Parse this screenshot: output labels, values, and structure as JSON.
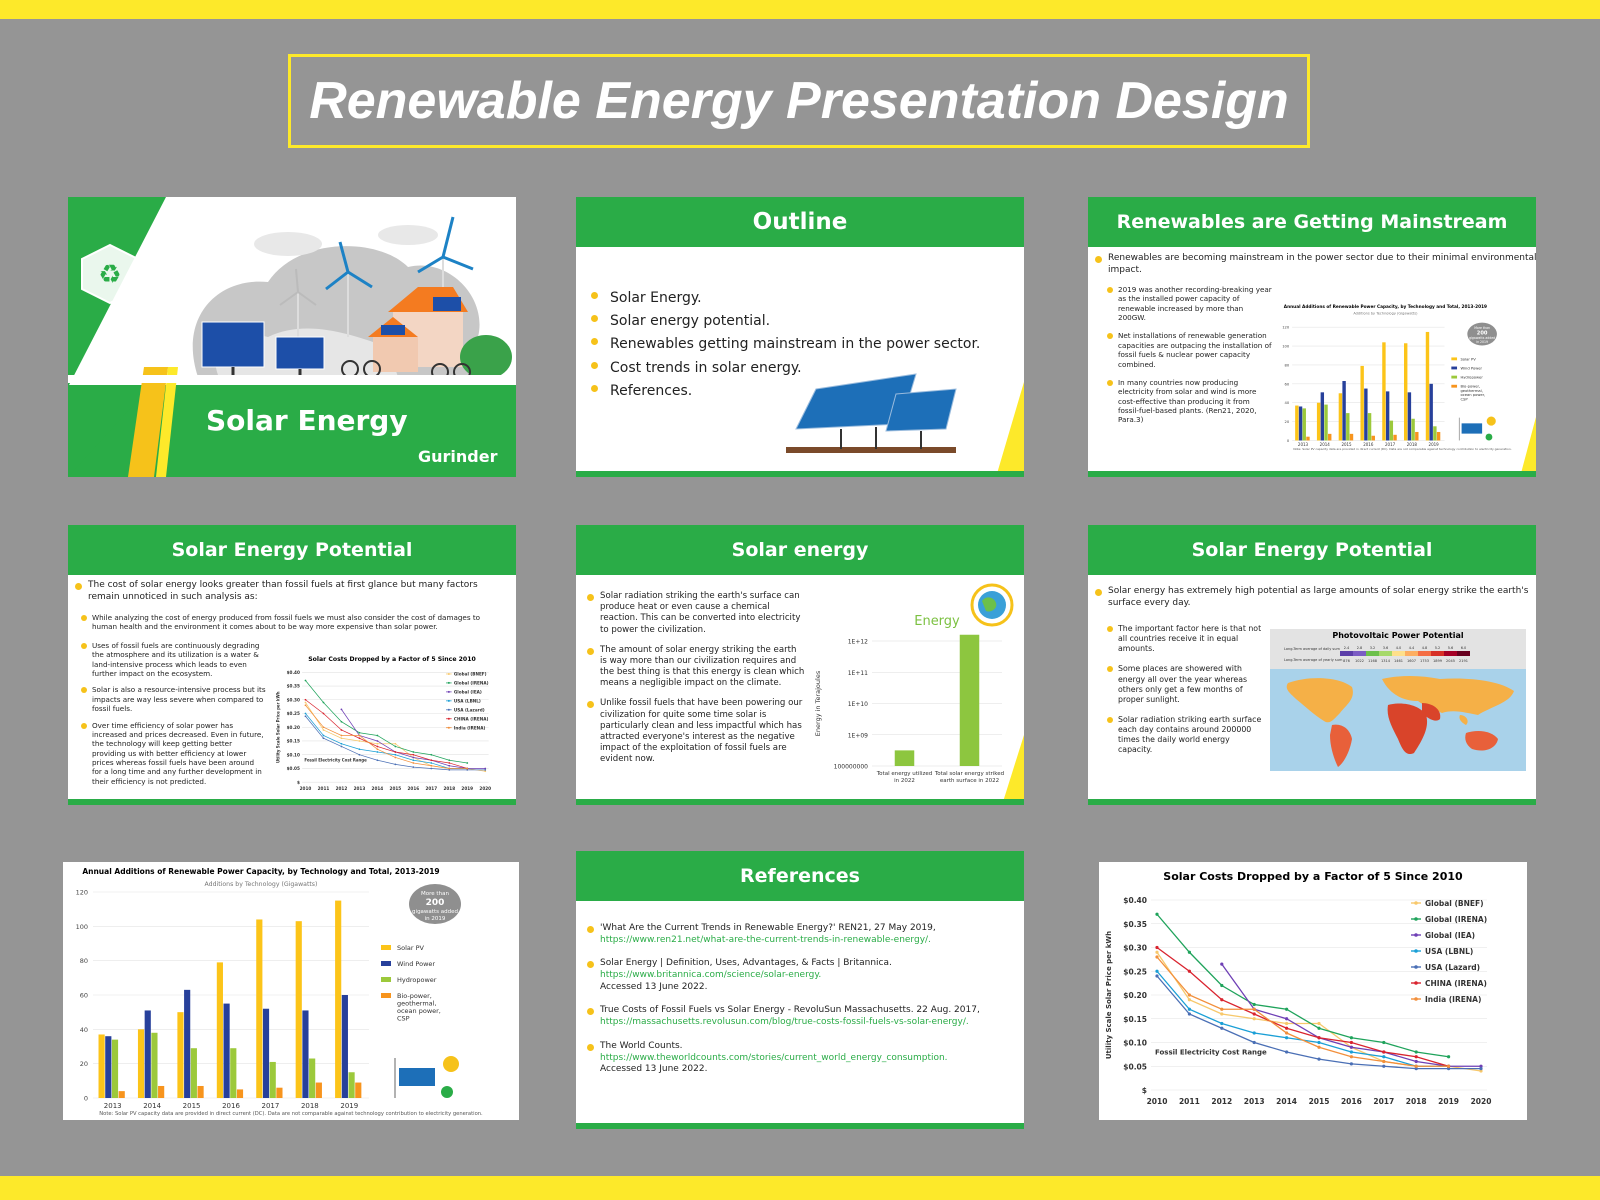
{
  "page_title": "Renewable Energy Presentation Design",
  "colors": {
    "background": "#959595",
    "accent_yellow": "#fde92a",
    "green": "#2aac47",
    "bullet": "#f6c21a"
  },
  "slide1": {
    "title": "Solar Energy",
    "author": "Gurinder"
  },
  "slide2": {
    "title": "Outline",
    "items": [
      "Solar Energy.",
      "Solar energy potential.",
      "Renewables getting mainstream in the power sector.",
      "Cost trends in solar energy.",
      "References."
    ]
  },
  "slide3": {
    "title": "Renewables are Getting Mainstream",
    "intro": "Renewables are becoming mainstream in the power sector due to their minimal environmental impact.",
    "bullets": [
      "2019 was another recording-breaking year as the installed power capacity of renewable increased by more than 200GW.",
      "Net installations of renewable generation capacities are outpacing the installation of fossil fuels & nuclear power capacity combined.",
      "In many countries now producing electricity from solar and wind is more cost-effective than producing it from fossil-fuel-based plants. (Ren21, 2020, Para.3)"
    ]
  },
  "slide4": {
    "title": "Solar Energy Potential",
    "intro": "The cost of solar energy looks greater than fossil fuels at first glance but many factors remain unnoticed in such analysis as:",
    "bullets": [
      "While analyzing the cost of energy produced from fossil fuels we must also consider the cost of damages to human health and the environment it comes about to be way more expensive than solar power.",
      "Uses of fossil fuels are continuously degrading the atmosphere and its utilization is a water & land-intensive process which leads to even further impact on the ecosystem.",
      "Solar is also a resource-intensive process but its impacts are way less severe when compared to fossil fuels.",
      "Over time efficiency of solar power has increased and prices decreased. Even in future, the technology will keep getting better providing us with better efficiency at lower prices whereas fossil fuels have been around for a long time and any further development in their efficiency is not predicted."
    ]
  },
  "slide5": {
    "title": "Solar energy",
    "bullets": [
      "Solar radiation striking the earth's surface can produce heat or even cause a chemical reaction. This can be converted into electricity to power the civilization.",
      "The amount of solar energy striking the earth is way more than our civilization requires and the best thing is that this energy is clean which means a negligible impact on the climate.",
      "Unlike fossil fuels that have been powering our civilization for quite some time solar is particularly clean and less impactful which has attracted everyone's interest as the negative impact of the exploitation of fossil fuels are evident now."
    ]
  },
  "slide6": {
    "title": "Solar Energy Potential",
    "intro": "Solar energy has extremely high potential as large amounts of solar energy strike the earth's surface every day.",
    "bullets": [
      "The important factor here is that not all countries receive it in equal amounts.",
      "Some places are showered with energy all over the year whereas others only get a few months of proper sunlight.",
      "Solar radiation striking earth surface each day contains around 200000 times the daily world energy capacity."
    ],
    "map_title": "Photovoltaic Power Potential",
    "map_row1_label": "Long-Term average of daily sum",
    "map_row2_label": "Long-Term average of yearly sum",
    "map_row1": [
      "2.4",
      "2.8",
      "3.2",
      "3.6",
      "4.0",
      "4.4",
      "4.8",
      "5.2",
      "5.6",
      "6.0"
    ],
    "map_row2": [
      "876",
      "1022",
      "1168",
      "1314",
      "1461",
      "1607",
      "1753",
      "1899",
      "2045",
      "2191"
    ]
  },
  "slide8": {
    "title": "References",
    "refs": [
      {
        "text": "'What Are the Current Trends in Renewable Energy?' REN21, 27 May 2019,",
        "link": "https://www.ren21.net/what-are-the-current-trends-in-renewable-energy/.",
        "note": ""
      },
      {
        "text": "Solar Energy | Definition, Uses, Advantages, & Facts | Britannica.",
        "link": "https://www.britannica.com/science/solar-energy.",
        "note": "Accessed 13 June 2022."
      },
      {
        "text": "True Costs of Fossil Fuels vs Solar Energy - RevoluSun Massachusetts. 22 Aug. 2017,",
        "link": "https://massachusetts.revolusun.com/blog/true-costs-fossil-fuels-vs-solar-energy/.",
        "note": ""
      },
      {
        "text": "The World Counts.",
        "link": "https://www.theworldcounts.com/stories/current_world_energy_consumption.",
        "note": "Accessed 13 June 2022."
      }
    ]
  },
  "chart_data": [
    {
      "id": "bar",
      "type": "bar",
      "title": "Annual Additions of Renewable Power Capacity, by Technology and Total, 2013-2019",
      "subtitle": "Additions by Technology (Gigawatts)",
      "categories": [
        "2013",
        "2014",
        "2015",
        "2016",
        "2017",
        "2018",
        "2019"
      ],
      "ylim": [
        0,
        120
      ],
      "yticks": [
        "0",
        "20",
        "40",
        "60",
        "80",
        "100",
        "120"
      ],
      "series": [
        {
          "name": "Solar PV",
          "color": "#fcc419",
          "values": [
            37,
            40,
            50,
            79,
            104,
            103,
            115
          ]
        },
        {
          "name": "Wind Power",
          "color": "#27409b",
          "values": [
            36,
            51,
            63,
            55,
            52,
            51,
            60
          ]
        },
        {
          "name": "Hydropower",
          "color": "#9cc93b",
          "values": [
            34,
            38,
            29,
            29,
            21,
            23,
            15
          ]
        },
        {
          "name": "Bio-power, geothermal, ocean power, CSP",
          "color": "#f7941d",
          "values": [
            4,
            7,
            7,
            5,
            6,
            9,
            9
          ]
        }
      ],
      "callout": {
        "line1": "More than",
        "value": "200",
        "line2": "gigawatts added",
        "line3": "in 2019"
      },
      "note": "Note: Solar PV capacity data are provided in direct current (DC). Data are not comparable against technology contribution to electricity generation."
    },
    {
      "id": "line",
      "type": "line",
      "title": "Solar Costs Dropped by a Factor of 5 Since 2010",
      "ylabel": "Utility Scale Solar Price per kWh",
      "x": [
        "2010",
        "2011",
        "2012",
        "2013",
        "2014",
        "2015",
        "2016",
        "2017",
        "2018",
        "2019",
        "2020"
      ],
      "ylim": [
        0,
        0.4
      ],
      "yticks": [
        "$",
        "$0.05",
        "$0.10",
        "$0.15",
        "$0.20",
        "$0.25",
        "$0.30",
        "$0.35",
        "$0.40"
      ],
      "fossil_range_label": "Fossil Electricity Cost Range",
      "series": [
        {
          "name": "Global (BNEF)",
          "color": "#f7c86b",
          "values": [
            0.29,
            0.19,
            0.16,
            0.15,
            0.14,
            0.14,
            0.09,
            0.06,
            0.05,
            0.05,
            0.04
          ]
        },
        {
          "name": "Global (IRENA)",
          "color": "#1fa35b",
          "values": [
            0.37,
            0.29,
            0.22,
            0.18,
            0.17,
            0.13,
            0.11,
            0.1,
            0.08,
            0.07,
            null
          ]
        },
        {
          "name": "Global (IEA)",
          "color": "#6e3fb5",
          "values": [
            null,
            null,
            0.265,
            0.17,
            0.15,
            0.11,
            0.09,
            0.08,
            0.06,
            0.05,
            0.05
          ]
        },
        {
          "name": "USA (LBNL)",
          "color": "#1a9fd6",
          "values": [
            0.25,
            0.17,
            0.14,
            0.12,
            0.11,
            0.1,
            0.08,
            0.07,
            0.05,
            0.05,
            null
          ]
        },
        {
          "name": "USA (Lazard)",
          "color": "#4a6fb5",
          "values": [
            0.24,
            0.16,
            0.13,
            0.1,
            0.08,
            0.065,
            0.055,
            0.05,
            0.045,
            0.045,
            0.045
          ]
        },
        {
          "name": "CHINA (IRENA)",
          "color": "#d9232e",
          "values": [
            0.3,
            0.25,
            0.19,
            0.16,
            0.13,
            0.11,
            0.1,
            0.08,
            0.07,
            0.05,
            null
          ]
        },
        {
          "name": "India (IRENA)",
          "color": "#f28f3b",
          "values": [
            0.28,
            0.2,
            0.17,
            0.17,
            0.12,
            0.09,
            0.07,
            0.06,
            0.05,
            0.05,
            null
          ]
        }
      ]
    },
    {
      "id": "energy",
      "type": "bar",
      "title": "Energy",
      "ylabel": "Energy in Terajoules",
      "yticks": [
        "100000000",
        "1E+09",
        "1E+10",
        "1E+11",
        "1E+12"
      ],
      "categories": [
        "Total energy utilized in 2022",
        "Total solar energy striked earth surface in 2022"
      ],
      "values_log10": [
        8.5,
        12.2
      ]
    }
  ]
}
